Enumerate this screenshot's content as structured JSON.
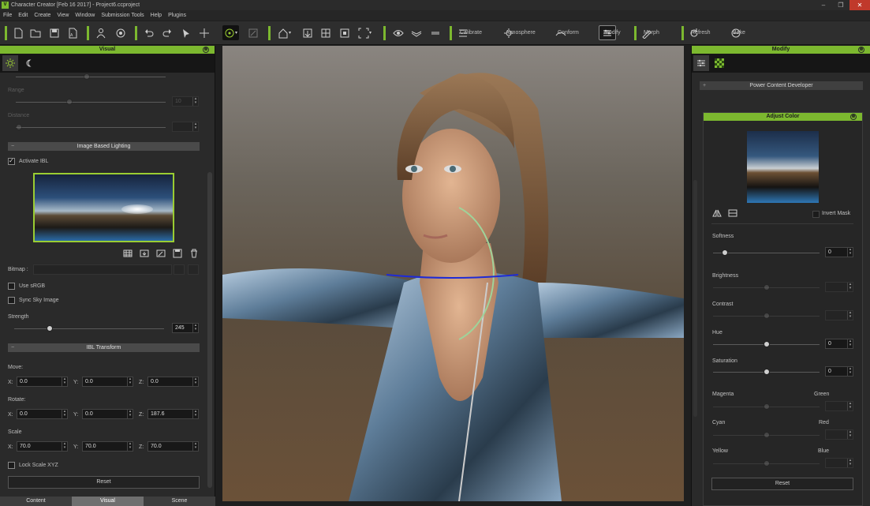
{
  "window": {
    "title": "Character Creator [Feb 16 2017] - Project6.ccproject",
    "logo": "V"
  },
  "menu": [
    "File",
    "Edit",
    "Create",
    "View",
    "Window",
    "Submission Tools",
    "Help",
    "Plugins"
  ],
  "toolbar": {
    "calibrate": "Calibrate",
    "atmosphere": "Atmosphere",
    "conform": "Conform",
    "modify": "Modify",
    "morph": "Morph",
    "refresh": "Refresh",
    "bake": "Bake",
    "accent": "#7cb82f"
  },
  "left_panel": {
    "title": "Visual",
    "faded_labels": [
      "Range",
      "Distance"
    ],
    "faded_value": "10",
    "ibl_section": "Image Based Lighting",
    "activate_ibl": {
      "label": "Activate IBL",
      "checked": true
    },
    "bitmap_label": "Bitmap :",
    "use_srgb": {
      "label": "Use sRGB",
      "checked": false
    },
    "sync_sky": {
      "label": "Sync Sky Image",
      "checked": false
    },
    "strength": {
      "label": "Strength",
      "value": "245"
    },
    "transform_section": "IBL Transform",
    "move": {
      "label": "Move:",
      "x": "0.0",
      "y": "0.0",
      "z": "0.0"
    },
    "rotate": {
      "label": "Rotate:",
      "x": "0.0",
      "y": "0.0",
      "z": "187.6"
    },
    "scale": {
      "label": "Scale",
      "x": "70.0",
      "y": "70.0",
      "z": "70.0"
    },
    "axis": {
      "x": "X:",
      "y": "Y:",
      "z": "Z:"
    },
    "lock_scale": {
      "label": "Lock Scale XYZ",
      "checked": false
    },
    "reset": "Reset",
    "bottom_tabs": [
      "Content",
      "Visual",
      "Scene"
    ]
  },
  "right_panel": {
    "title": "Modify",
    "pcd": "Power Content Developer",
    "adjust_title": "Adjust Color",
    "invert_mask": "Invert Mask",
    "softness": {
      "label": "Softness",
      "value": "0"
    },
    "brightness": {
      "label": "Brightness"
    },
    "contrast": {
      "label": "Contrast"
    },
    "hue": {
      "label": "Hue",
      "value": "0"
    },
    "saturation": {
      "label": "Saturation",
      "value": "0"
    },
    "magenta": "Magenta",
    "green": "Green",
    "cyan": "Cyan",
    "red": "Red",
    "yellow": "Yellow",
    "blue": "Blue",
    "reset": "Reset"
  }
}
